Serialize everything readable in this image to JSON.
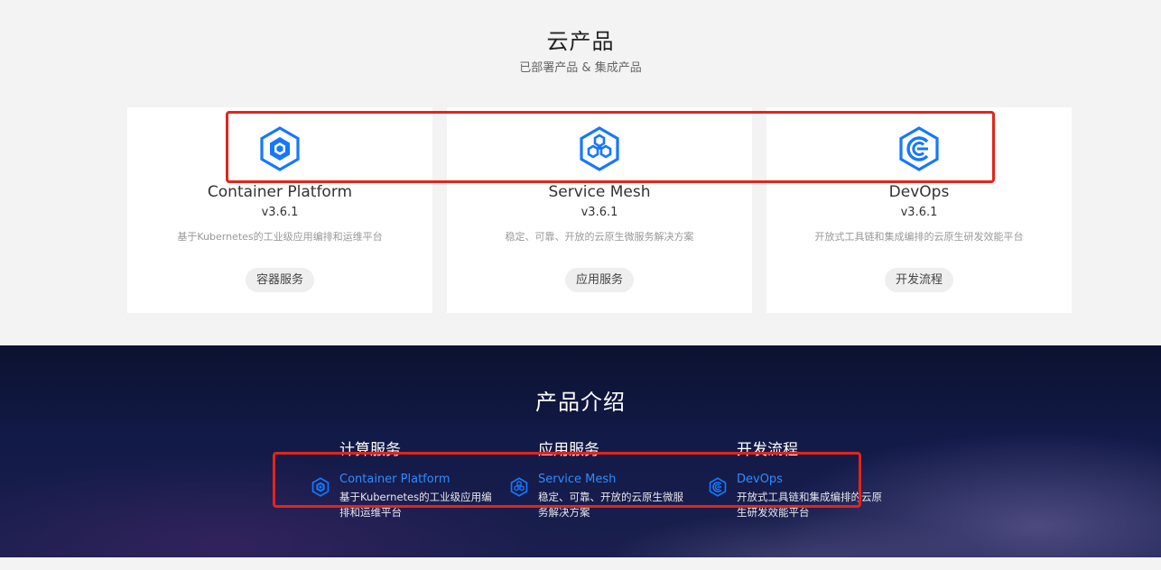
{
  "cloud_products": {
    "title": "云产品",
    "subtitle": "已部署产品 & 集成产品",
    "cards": [
      {
        "icon": "container-platform-icon",
        "name": "Container Platform",
        "version": "v3.6.1",
        "description": "基于Kubernetes的工业级应用编排和运维平台",
        "tag": "容器服务"
      },
      {
        "icon": "service-mesh-icon",
        "name": "Service Mesh",
        "version": "v3.6.1",
        "description": "稳定、可靠、开放的云原生微服务解决方案",
        "tag": "应用服务"
      },
      {
        "icon": "devops-icon",
        "name": "DevOps",
        "version": "v3.6.1",
        "description": "开放式工具链和集成编排的云原生研发效能平台",
        "tag": "开发流程"
      }
    ]
  },
  "product_intro": {
    "title": "产品介绍",
    "columns": [
      {
        "heading": "计算服务",
        "product": {
          "icon": "container-platform-icon",
          "name": "Container Platform",
          "description": "基于Kubernetes的工业级应用编排和运维平台"
        }
      },
      {
        "heading": "应用服务",
        "product": {
          "icon": "service-mesh-icon",
          "name": "Service Mesh",
          "description": "稳定、可靠、开放的云原生微服务解决方案"
        }
      },
      {
        "heading": "开发流程",
        "product": {
          "icon": "devops-icon",
          "name": "DevOps",
          "description": "开放式工具链和集成编排的云原生研发效能平台"
        }
      }
    ]
  },
  "colors": {
    "accent": "#1677ff",
    "link": "#2f8cff",
    "highlight": "#e5231c",
    "dark_bg": "#121a48"
  }
}
